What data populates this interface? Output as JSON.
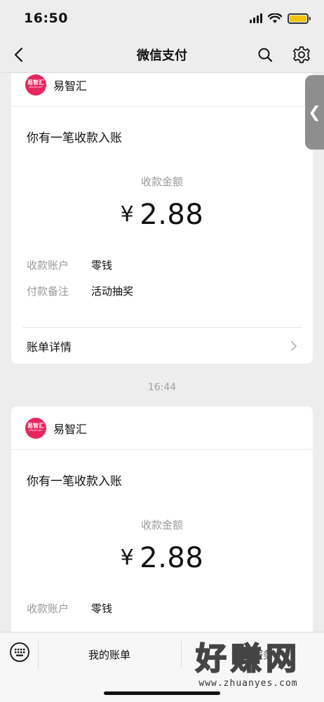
{
  "status_bar": {
    "time": "16:50"
  },
  "nav": {
    "title": "微信支付"
  },
  "side_tab": {
    "glyph": "❮"
  },
  "cards": [
    {
      "merchant": {
        "name": "易智汇",
        "logo_text": "易智汇",
        "logo_sub": "bitsyb.com"
      },
      "title": "你有一笔收款入账",
      "amount_label": "收款金额",
      "currency": "¥",
      "amount": "2.88",
      "rows": [
        {
          "key": "收款账户",
          "value": "零钱"
        },
        {
          "key": "付款备注",
          "value": "活动抽奖"
        }
      ],
      "detail_link": "账单详情"
    },
    {
      "merchant": {
        "name": "易智汇",
        "logo_text": "易智汇",
        "logo_sub": "bitsyb.com"
      },
      "title": "你有一笔收款入账",
      "amount_label": "收款金额",
      "currency": "¥",
      "amount": "2.88",
      "rows": [
        {
          "key": "收款账户",
          "value": "零钱"
        }
      ]
    }
  ],
  "timestamp": "16:44",
  "bottom_bar": {
    "items": [
      {
        "label": "我的账单"
      },
      {
        "label": "卡券服务"
      }
    ]
  },
  "watermark": {
    "text": "好赚网",
    "url": "www.zhuanyes.com"
  },
  "colors": {
    "accent_logo": "#e8265e",
    "background": "#ededed",
    "card": "#ffffff",
    "muted_text": "#9a9a9a"
  }
}
